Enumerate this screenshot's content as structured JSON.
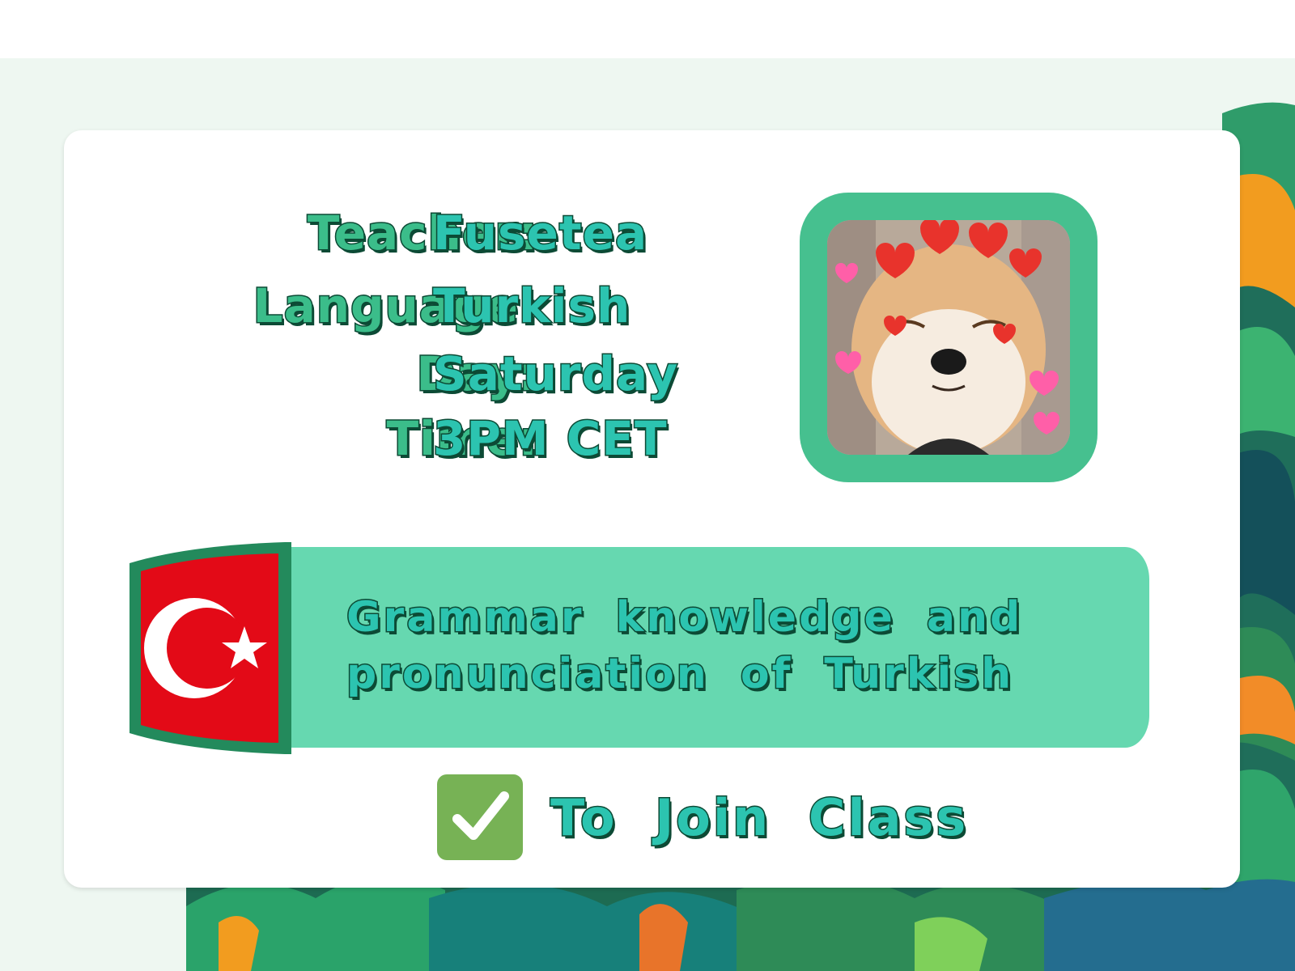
{
  "info": {
    "teacher_label": "Teacher:",
    "teacher_value": "Fusetea",
    "language_label": "Language:",
    "language_value": "Turkish",
    "day_label": "Day:",
    "day_value": "Saturday",
    "time_label": "Time:",
    "time_value": "3PM CET"
  },
  "description": {
    "line1": "Grammar knowledge and",
    "line2": "pronunciation of Turkish"
  },
  "join": {
    "label": "To Join Class",
    "icon": "check-mark-icon"
  },
  "colors": {
    "accent_green": "#46c08f",
    "banner_green": "#66d8b0",
    "text_teal": "#2cc4b0",
    "outline": "#0c4a35",
    "flag_red": "#e30a17",
    "check_green": "#77b255"
  }
}
